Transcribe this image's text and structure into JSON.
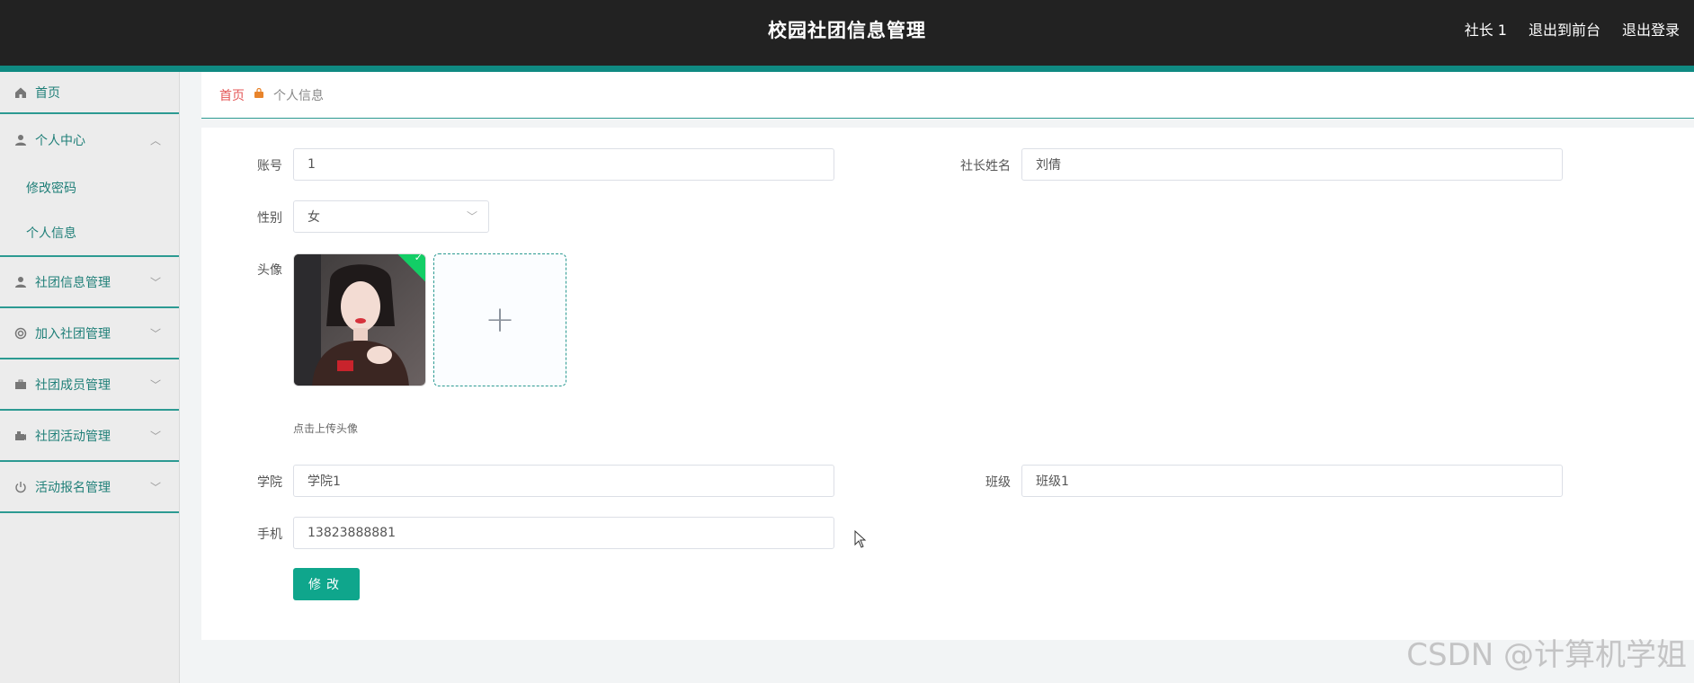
{
  "header": {
    "title": "校园社团信息管理",
    "user": "社长 1",
    "to_frontend": "退出到前台",
    "logout": "退出登录"
  },
  "sidebar": {
    "home": "首页",
    "personal_center": "个人中心",
    "change_password": "修改密码",
    "personal_info": "个人信息",
    "menus": [
      {
        "label": "社团信息管理",
        "icon": "user-icon"
      },
      {
        "label": "加入社团管理",
        "icon": "lifebuoy-icon"
      },
      {
        "label": "社团成员管理",
        "icon": "briefcase-icon"
      },
      {
        "label": "社团活动管理",
        "icon": "camera-icon"
      },
      {
        "label": "活动报名管理",
        "icon": "power-icon"
      }
    ]
  },
  "breadcrumb": {
    "home": "首页",
    "current": "个人信息"
  },
  "form": {
    "account_label": "账号",
    "account_value": "1",
    "name_label": "社长姓名",
    "name_value": "刘倩",
    "gender_label": "性别",
    "gender_value": "女",
    "avatar_label": "头像",
    "avatar_hint": "点击上传头像",
    "college_label": "学院",
    "college_value": "学院1",
    "class_label": "班级",
    "class_value": "班级1",
    "phone_label": "手机",
    "phone_value": "13823888881",
    "submit_label": "修改"
  },
  "watermark": "CSDN @计算机学姐",
  "colors": {
    "header_bg": "#222222",
    "accent": "#0f8a82",
    "button": "#0fa68c"
  }
}
